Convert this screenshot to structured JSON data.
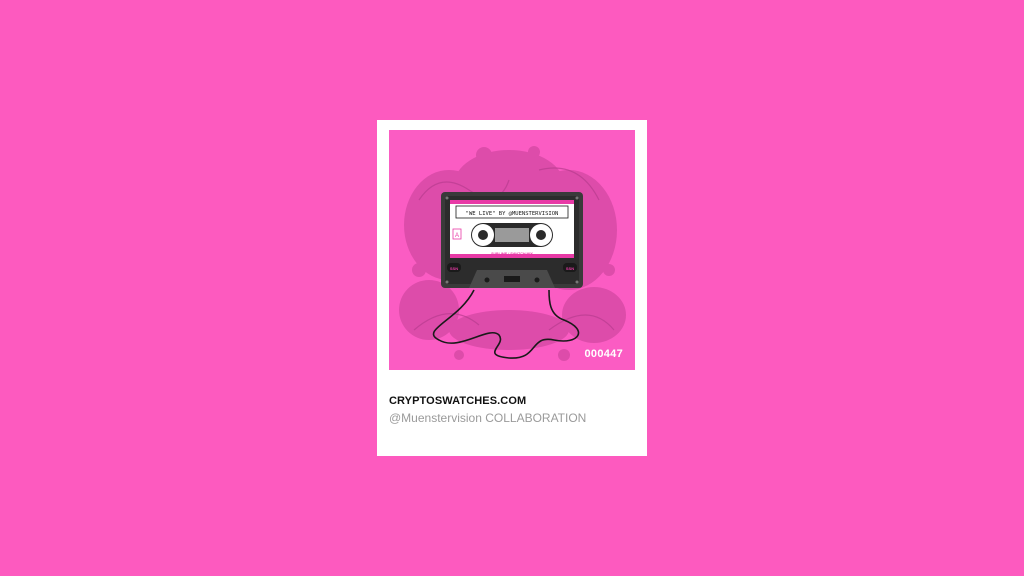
{
  "card": {
    "brand": "CRYPTOSWATCHES.COM",
    "subtitle": "@Muenstervision COLLABORATION",
    "edition_number": "000447"
  },
  "cassette": {
    "label_text": "\"WE LIVE\" BY @MUENSTERVISION",
    "side": "A",
    "subtitle": "SUBLIME / SWATCH MIX",
    "badge_left": "SSN",
    "badge_right": "SSN"
  },
  "colors": {
    "page_background": "#fd5abf",
    "art_background": "#fb5cc3",
    "cassette_body": "#3a3a3a",
    "label_accent": "#e83aa6"
  }
}
